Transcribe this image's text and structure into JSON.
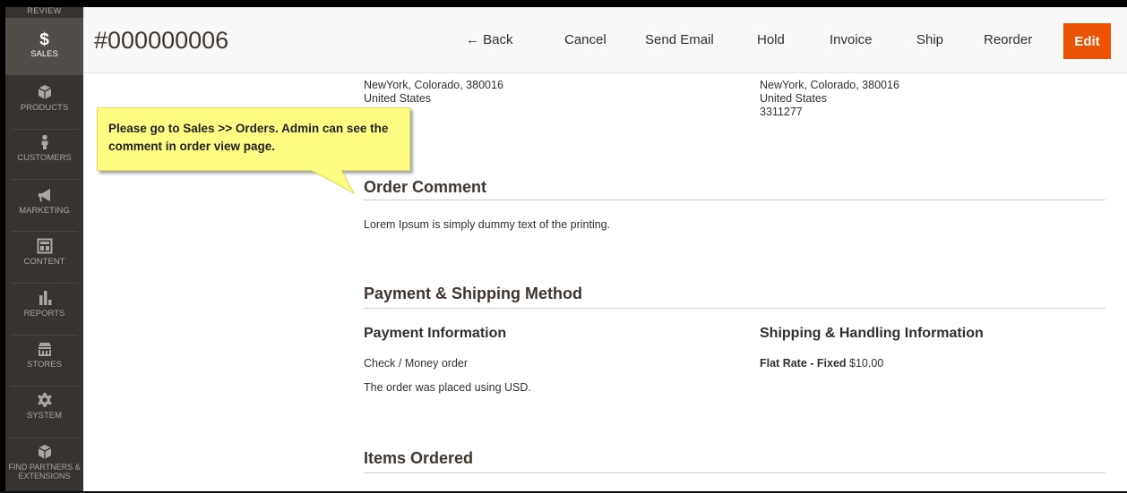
{
  "sidebar": {
    "review_label": "REVIEW",
    "items": [
      {
        "label": "SALES",
        "icon": "dollar-icon"
      },
      {
        "label": "PRODUCTS",
        "icon": "cube-icon"
      },
      {
        "label": "CUSTOMERS",
        "icon": "person-icon"
      },
      {
        "label": "MARKETING",
        "icon": "megaphone-icon"
      },
      {
        "label": "CONTENT",
        "icon": "layout-icon"
      },
      {
        "label": "REPORTS",
        "icon": "bar-chart-icon"
      },
      {
        "label": "STORES",
        "icon": "store-icon"
      },
      {
        "label": "SYSTEM",
        "icon": "gear-icon"
      },
      {
        "label": "FIND PARTNERS & EXTENSIONS",
        "icon": "box-icon"
      }
    ],
    "dollar_glyph": "$"
  },
  "header": {
    "order_number": "#000000006",
    "back_label": "← Back",
    "cancel_label": "Cancel",
    "send_email_label": "Send Email",
    "hold_label": "Hold",
    "invoice_label": "Invoice",
    "ship_label": "Ship",
    "reorder_label": "Reorder",
    "edit_label": "Edit",
    "accent_color": "#eb5202"
  },
  "billing_address": {
    "line1": "NewYork, Colorado, 380016",
    "line2": "United States"
  },
  "shipping_address": {
    "line1": "NewYork, Colorado, 380016",
    "line2": "United States",
    "line3": "3311277"
  },
  "callout": {
    "text": "Please go to Sales >> Orders. Admin can see the comment in order view page.",
    "background": "#fdfc83"
  },
  "order_comment": {
    "title": "Order Comment",
    "text": "Lorem Ipsum is simply dummy text of the printing."
  },
  "payment_shipping": {
    "title": "Payment & Shipping Method",
    "payment_title": "Payment Information",
    "payment_method": "Check / Money order",
    "payment_note": "The order was placed using USD.",
    "shipping_title": "Shipping & Handling Information",
    "shipping_method": "Flat Rate - Fixed",
    "shipping_price": "$10.00"
  },
  "items_ordered": {
    "title": "Items Ordered"
  }
}
